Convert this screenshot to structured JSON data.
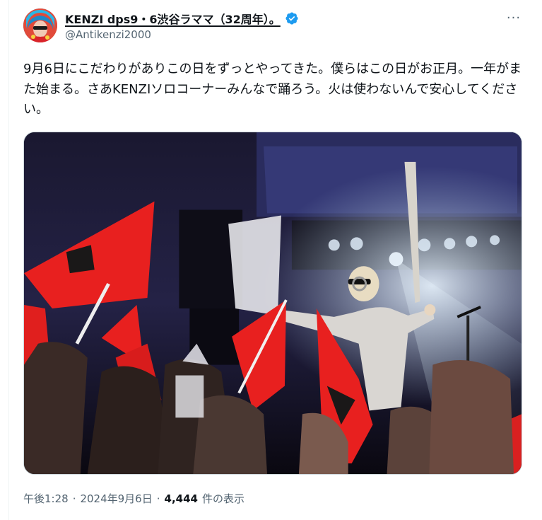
{
  "author": {
    "display_name": "KENZI dps9・6渋谷ラママ（32周年）。",
    "handle": "@Antikenzi2000",
    "verified_icon": "verified-badge-icon",
    "verified_color": "#1d9bf0"
  },
  "menu": {
    "more_icon": "more-horizontal-icon",
    "more_label": "···"
  },
  "tweet": {
    "text": "9月6日にこだわりがありこの日をずっとやってきた。僕らはこの日がお正月。一年がまた始まる。さあKENZIソロコーナーみんなで踊ろう。火は使わないんで安心してください。"
  },
  "meta": {
    "time": "午後1:28",
    "separator": "·",
    "date": "2024年9月6日",
    "views_count": "4,444",
    "views_label": "件の表示"
  },
  "colors": {
    "text_primary": "#0f1419",
    "text_secondary": "#536471",
    "flag_red": "#e8201f",
    "stage_purple": "#3d3a78"
  }
}
